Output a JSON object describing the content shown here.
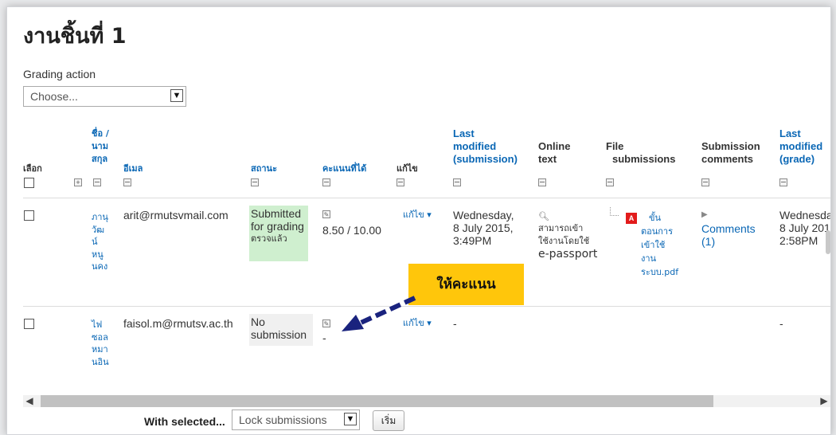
{
  "page_title": "งานชิ้นที่ 1",
  "grading_action": {
    "label": "Grading action",
    "value": "Choose..."
  },
  "table": {
    "headers": {
      "select": "เลือก",
      "name": [
        "ชื่อ /",
        "นาม",
        "สกุล"
      ],
      "email": "อีเมล",
      "status": "สถานะ",
      "grade": "คะแนนที่ได้",
      "edit": "แก้ไข",
      "last_modified_submission": [
        "Last",
        "modified",
        "(submission)"
      ],
      "online_text": [
        "Online",
        "text"
      ],
      "file_submissions": [
        "File",
        "submissions"
      ],
      "submission_comments": [
        "Submission",
        "comments"
      ],
      "last_modified_grade": [
        "Last",
        "modified",
        "(grade)"
      ]
    },
    "rows": [
      {
        "name": [
          "ภานุ",
          "วัฒ",
          "น์",
          "หนู",
          "นคง"
        ],
        "email": "arit@rmutsvmail.com",
        "status": [
          "Submitted",
          "for grading"
        ],
        "status_thai": "ตรวจแล้ว",
        "grade": "8.50 / 10.00",
        "edit": "แก้ไข ▾",
        "last_modified": [
          "Wednesday,",
          "8 July 2015,",
          "3:49PM"
        ],
        "online_text": [
          "สามารถเข้า",
          "ใช้งานโดยใช้"
        ],
        "online_text_extra": "e-passport",
        "file": [
          "ขั้น",
          "ตอนการ",
          "เข้าใช้",
          "งาน",
          "ระบบ.pdf"
        ],
        "comments": [
          "Comments",
          "(1)"
        ],
        "grade_modified": [
          "Wednesda",
          "8 July 201",
          "2:58PM"
        ]
      },
      {
        "name": [
          "ไฟ",
          "ซอล",
          "หมา",
          "นอิน"
        ],
        "email": "faisol.m@rmutsv.ac.th",
        "status": [
          "No",
          "submission"
        ],
        "grade": "-",
        "edit": "แก้ไข ▾",
        "last_modified": "-",
        "grade_modified": "-"
      }
    ]
  },
  "callout": "ให้คะแนน",
  "bulk": {
    "label": "With selected...",
    "value": "Lock submissions",
    "go": "เริ่ม"
  },
  "colors": {
    "link": "#0a67b5",
    "submitted_bg": "#cfefcf",
    "callout_bg": "#ffc60b",
    "arrow": "#1a237e"
  }
}
